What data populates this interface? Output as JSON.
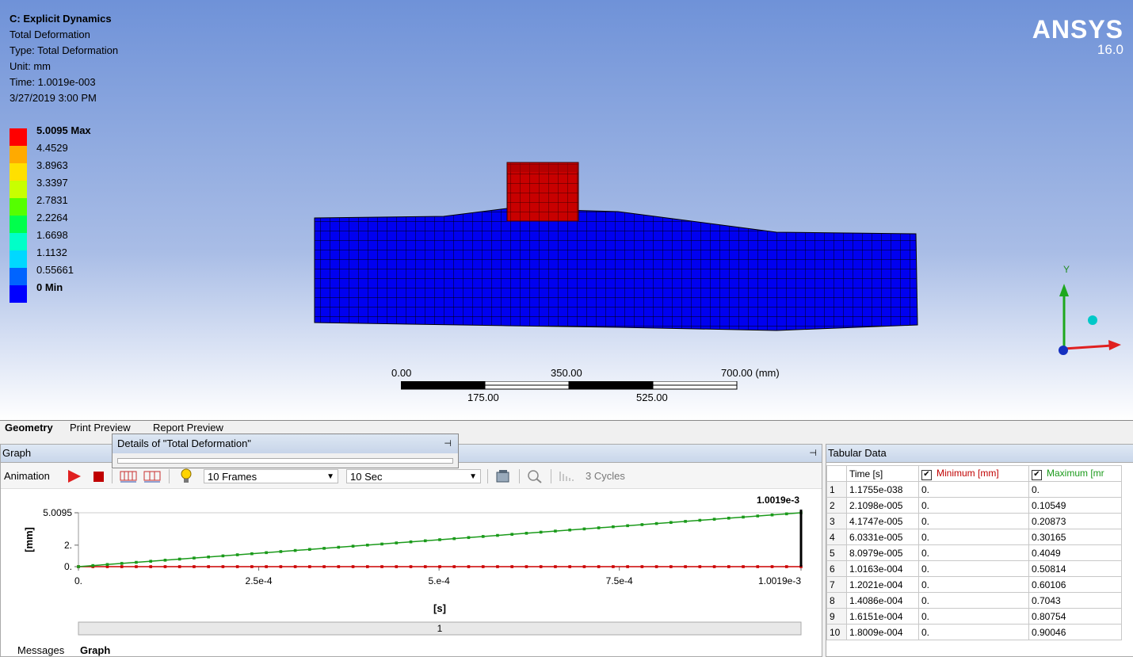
{
  "viewport": {
    "info": {
      "system": "C: Explicit Dynamics",
      "result": "Total Deformation",
      "type": "Type: Total Deformation",
      "unit": "Unit: mm",
      "time": "Time: 1.0019e-003",
      "date": "3/27/2019 3:00 PM"
    },
    "legend": [
      {
        "label": "5.0095 Max",
        "color": "#ff0000",
        "bold": true
      },
      {
        "label": "4.4529",
        "color": "#ffaa00"
      },
      {
        "label": "3.8963",
        "color": "#ffe000"
      },
      {
        "label": "3.3397",
        "color": "#c8ff00"
      },
      {
        "label": "2.7831",
        "color": "#55ff00"
      },
      {
        "label": "2.2264",
        "color": "#00ff4c"
      },
      {
        "label": "1.6698",
        "color": "#00ffc8"
      },
      {
        "label": "1.1132",
        "color": "#00d8ff"
      },
      {
        "label": "0.55661",
        "color": "#0064ff"
      },
      {
        "label": "0 Min",
        "color": "#0000ff",
        "bold": true
      }
    ],
    "brand": "ANSYS",
    "version": "16.0",
    "scale": {
      "top": [
        "0.00",
        "350.00",
        "700.00 (mm)"
      ],
      "bottom": [
        "175.00",
        "525.00"
      ]
    },
    "triad": {
      "y_label": "Y"
    }
  },
  "tabs": [
    "Geometry",
    "Print Preview",
    "Report Preview"
  ],
  "details_title": "Details of \"Total Deformation\"",
  "graph": {
    "title": "Graph",
    "animation_label": "Animation",
    "frames": "10 Frames",
    "duration": "10 Sec",
    "cycles": "3 Cycles",
    "time_marker": "1.0019e-3",
    "slider_value": "1"
  },
  "chart_data": {
    "type": "line",
    "xlabel": "[s]",
    "ylabel": "[mm]",
    "x_ticks": [
      "0.",
      "2.5e-4",
      "5.e-4",
      "7.5e-4",
      "1.0019e-3"
    ],
    "y_ticks": [
      "0.",
      "2.",
      "5.0095"
    ],
    "xlim": [
      0,
      0.0010019
    ],
    "ylim": [
      0,
      5.0095
    ],
    "series": [
      {
        "name": "Minimum [mm]",
        "color": "#cc0000",
        "x": [
          0,
          0.0010019
        ],
        "y": [
          0,
          0
        ]
      },
      {
        "name": "Maximum [mm]",
        "color": "#1a9a1a",
        "x": [
          0,
          0.0010019
        ],
        "y": [
          0,
          5.0095
        ]
      }
    ]
  },
  "tabular": {
    "title": "Tabular Data",
    "headers": [
      "Time [s]",
      "Minimum [mm]",
      "Maximum [mr"
    ],
    "rows": [
      [
        "1",
        "1.1755e-038",
        "0.",
        "0."
      ],
      [
        "2",
        "2.1098e-005",
        "0.",
        "0.10549"
      ],
      [
        "3",
        "4.1747e-005",
        "0.",
        "0.20873"
      ],
      [
        "4",
        "6.0331e-005",
        "0.",
        "0.30165"
      ],
      [
        "5",
        "8.0979e-005",
        "0.",
        "0.4049"
      ],
      [
        "6",
        "1.0163e-004",
        "0.",
        "0.50814"
      ],
      [
        "7",
        "1.2021e-004",
        "0.",
        "0.60106"
      ],
      [
        "8",
        "1.4086e-004",
        "0.",
        "0.7043"
      ],
      [
        "9",
        "1.6151e-004",
        "0.",
        "0.80754"
      ],
      [
        "10",
        "1.8009e-004",
        "0.",
        "0.90046"
      ]
    ]
  },
  "bottom_tabs": [
    "Messages",
    "Graph"
  ]
}
